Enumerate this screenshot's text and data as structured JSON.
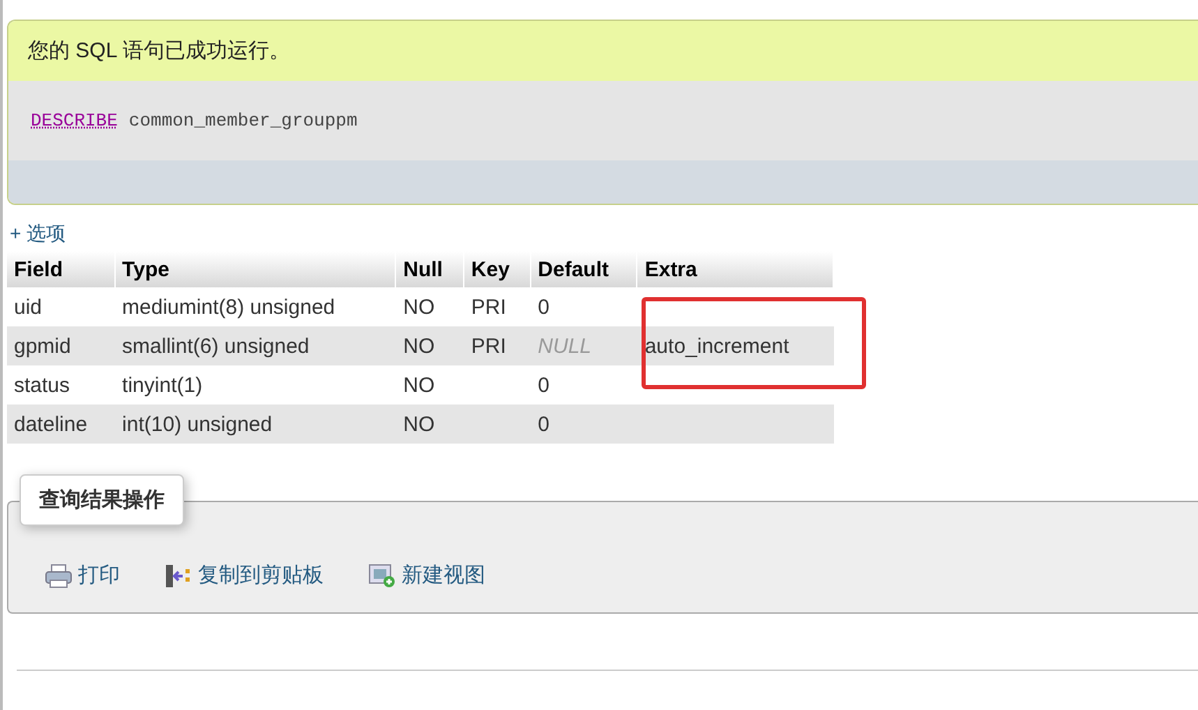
{
  "success_message": "您的 SQL 语句已成功运行。",
  "sql": {
    "keyword": "DESCRIBE",
    "rest": "common_member_grouppm"
  },
  "options_link": "+ 选项",
  "table": {
    "columns": [
      "Field",
      "Type",
      "Null",
      "Key",
      "Default",
      "Extra"
    ],
    "annotation": {
      "kind": "rectangle"
    },
    "rows": [
      {
        "cells": [
          "uid",
          "mediumint(8) unsigned",
          "NO",
          "PRI",
          "0",
          ""
        ],
        "null_default": false
      },
      {
        "cells": [
          "gpmid",
          "smallint(6) unsigned",
          "NO",
          "PRI",
          "NULL",
          "auto_increment"
        ],
        "null_default": true
      },
      {
        "cells": [
          "status",
          "tinyint(1)",
          "NO",
          "",
          "0",
          ""
        ],
        "null_default": false
      },
      {
        "cells": [
          "dateline",
          "int(10) unsigned",
          "NO",
          "",
          "0",
          ""
        ],
        "null_default": false
      }
    ]
  },
  "operations": {
    "legend": "查询结果操作",
    "actions": [
      {
        "kind": "print",
        "label": "打印"
      },
      {
        "kind": "copy",
        "label": "复制到剪贴板"
      },
      {
        "kind": "view",
        "label": "新建视图"
      }
    ]
  }
}
